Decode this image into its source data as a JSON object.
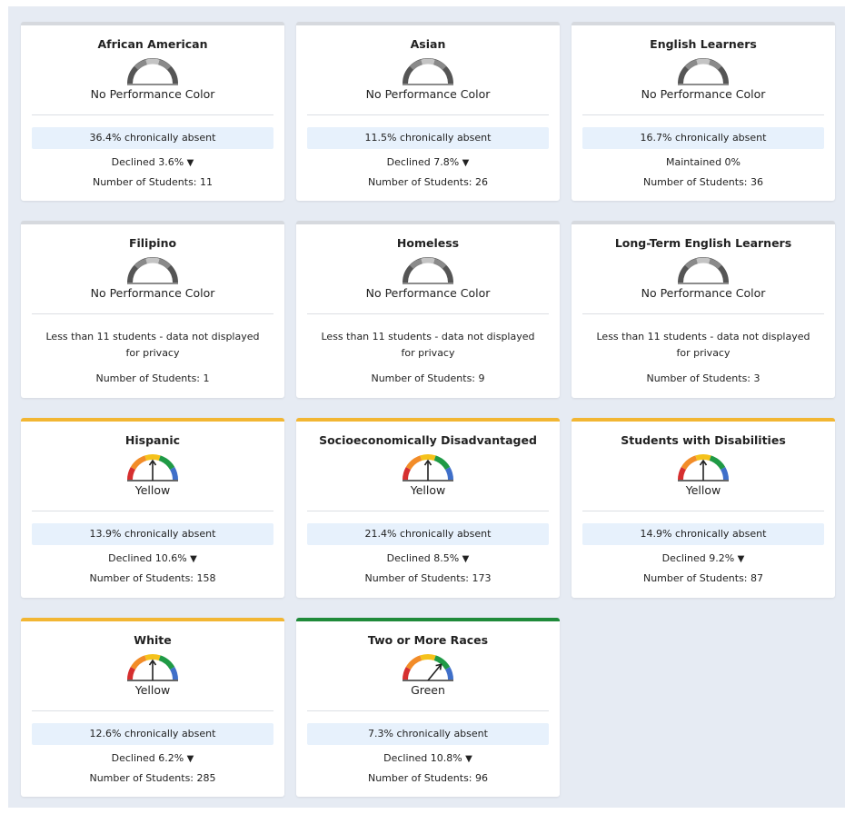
{
  "cards": [
    {
      "title": "African American",
      "color": "No Performance Color",
      "absent": "36.4% chronically absent",
      "change": "Declined 3.6%",
      "arrow": "▼",
      "students": "Number of Students: 11"
    },
    {
      "title": "Asian",
      "color": "No Performance Color",
      "absent": "11.5% chronically absent",
      "change": "Declined 7.8%",
      "arrow": "▼",
      "students": "Number of Students: 26"
    },
    {
      "title": "English Learners",
      "color": "No Performance Color",
      "absent": "16.7% chronically absent",
      "change": "Maintained 0%",
      "arrow": "",
      "students": "Number of Students: 36"
    },
    {
      "title": "Filipino",
      "color": "No Performance Color",
      "privacy": "Less than 11 students - data not displayed for privacy",
      "students": "Number of Students: 1"
    },
    {
      "title": "Homeless",
      "color": "No Performance Color",
      "privacy": "Less than 11 students - data not displayed for privacy",
      "students": "Number of Students: 9"
    },
    {
      "title": "Long-Term English Learners",
      "color": "No Performance Color",
      "privacy": "Less than 11 students - data not displayed for privacy",
      "students": "Number of Students: 3"
    },
    {
      "title": "Hispanic",
      "color": "Yellow",
      "absent": "13.9% chronically absent",
      "change": "Declined 10.6%",
      "arrow": "▼",
      "students": "Number of Students: 158"
    },
    {
      "title": "Socioeconomically Disadvantaged",
      "color": "Yellow",
      "absent": "21.4% chronically absent",
      "change": "Declined 8.5%",
      "arrow": "▼",
      "students": "Number of Students: 173"
    },
    {
      "title": "Students with Disabilities",
      "color": "Yellow",
      "absent": "14.9% chronically absent",
      "change": "Declined 9.2%",
      "arrow": "▼",
      "students": "Number of Students: 87"
    },
    {
      "title": "White",
      "color": "Yellow",
      "absent": "12.6% chronically absent",
      "change": "Declined 6.2%",
      "arrow": "▼",
      "students": "Number of Students: 285"
    },
    {
      "title": "Two or More Races",
      "color": "Green",
      "absent": "7.3% chronically absent",
      "change": "Declined 10.8%",
      "arrow": "▼",
      "students": "Number of Students: 96"
    }
  ],
  "palette": {
    "gauge_red": "#d62f2f",
    "gauge_orange": "#f28c28",
    "gauge_yellow": "#f5c21b",
    "gauge_green": "#1f9a45",
    "gauge_blue": "#3f6fc9",
    "gauge_none_dark": "#555555",
    "gauge_none_mid": "#8a8a8a",
    "gauge_none_light": "#c4c4c4",
    "accent_yellow": "#f2b633",
    "accent_green": "#1f8a3a",
    "absent_bg": "#e7f1fc"
  }
}
